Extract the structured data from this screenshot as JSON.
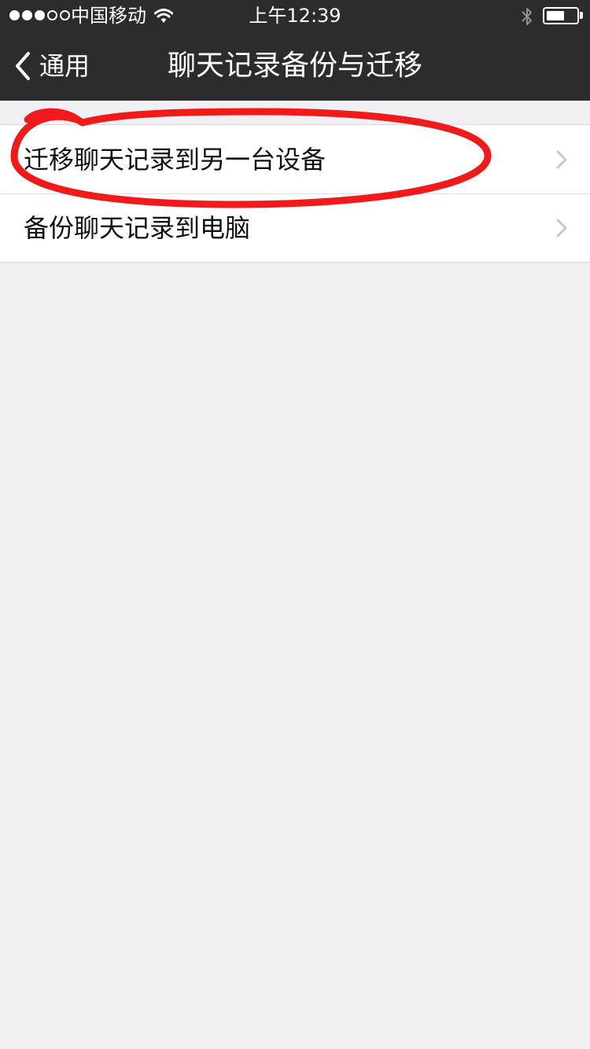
{
  "status_bar": {
    "carrier": "中国移动",
    "time": "上午12:39",
    "signal_bars_filled": 3,
    "signal_bars_total": 5,
    "battery_level": 0.6
  },
  "nav": {
    "back_label": "通用",
    "title": "聊天记录备份与迁移"
  },
  "list": {
    "items": [
      {
        "label": "迁移聊天记录到另一台设备"
      },
      {
        "label": "备份聊天记录到电脑"
      }
    ]
  },
  "colors": {
    "nav_background": "#2c2c2e",
    "page_background": "#efeff4",
    "annotation": "#f01a1a"
  },
  "icons": [
    "wifi-icon",
    "bluetooth-icon",
    "battery-icon",
    "back-chevron-icon",
    "chevron-right-icon"
  ]
}
